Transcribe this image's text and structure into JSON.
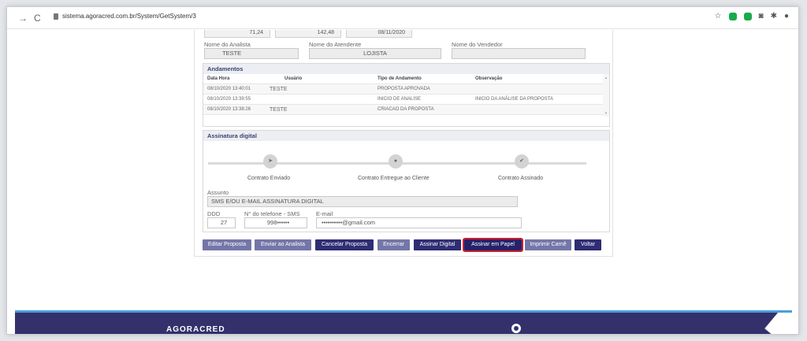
{
  "browser": {
    "back_label": "→",
    "reload_label": "C",
    "url": "sistema.agoracred.com.br/System/GetSystem/3"
  },
  "top_row": {
    "values": [
      "71,24",
      "142,48",
      "08/11/2020"
    ]
  },
  "labels": {
    "nome_analista": "Nome do Analista",
    "nome_atendente": "Nome do Atendente",
    "nome_vendedor": "Nome do Vendedor"
  },
  "values": {
    "nome_analista": "TESTE",
    "nome_atendente": "LOJISTA",
    "nome_vendedor": ""
  },
  "andamentos": {
    "title": "Andamentos",
    "headers": [
      "Data Hora",
      "Usuário",
      "Tipo de Andamento",
      "Observação"
    ],
    "rows": [
      [
        "08/10/2020 13:40:01",
        "TESTE",
        "PROPOSTA APROVADA",
        ""
      ],
      [
        "08/10/2020 13:39:55",
        "",
        "INICIO DE ANALISE",
        "INICIO DA ANÁLISE DA PROPOSTA"
      ],
      [
        "08/10/2020 13:38:26",
        "TESTE",
        "CRIACAO DA PROPOSTA",
        ""
      ]
    ]
  },
  "assinatura": {
    "title": "Assinatura digital",
    "steps": [
      "Contrato Enviado",
      "Contrato Entregue ao Cliente",
      "Contrato Assinado"
    ],
    "assunto_label": "Assunto",
    "assunto_value": "SMS E/OU E-MAIL ASSINATURA DIGITAL",
    "ddd_label": "DDD",
    "phone_label": "N° do telefone - SMS",
    "email_label": "E-mail",
    "ddd_value": "27",
    "phone_value": "998••••••",
    "email_value": "••••••••••@gmail.com"
  },
  "buttons": {
    "editar": "Editar Proposta",
    "enviar": "Enviar ao Analista",
    "cancelar": "Cancelar Proposta",
    "encerrar": "Encerrar",
    "assinar_digital": "Assinar Digital",
    "assinar_papel": "Assinar em Papel",
    "imprimir": "Imprimir Carnê",
    "voltar": "Voltar"
  },
  "footer": {
    "brand": "AGORACRED"
  },
  "colors": {
    "primary": "#2f2d74",
    "secondary": "#7476a8",
    "highlight": "#d41e2d",
    "footer_accent": "#4a9fd8"
  }
}
